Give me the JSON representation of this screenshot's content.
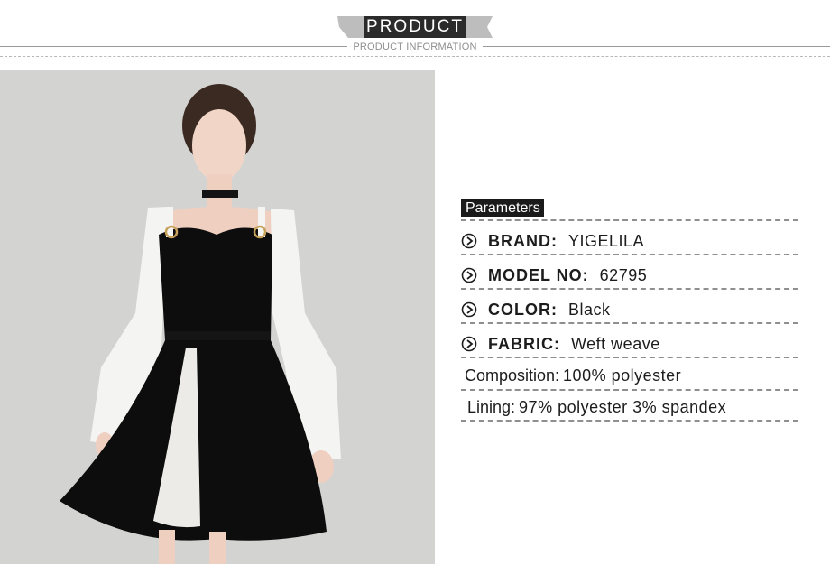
{
  "header": {
    "title": "PRODUCT",
    "subtitle": "PRODUCT INFORMATION"
  },
  "photo": {
    "alt": "Model wearing black cold-shoulder dress with white flared sleeves"
  },
  "parameters": {
    "heading": "Parameters",
    "rows": [
      {
        "label": "BRAND:",
        "value": "YIGELILA"
      },
      {
        "label": "MODEL NO:",
        "value": "62795"
      },
      {
        "label": "COLOR:",
        "value": "Black"
      },
      {
        "label": "FABRIC:",
        "value": "Weft weave"
      },
      {
        "label": "Composition:",
        "value": "100% polyester"
      },
      {
        "label": "Lining:",
        "value": "97% polyester 3% spandex"
      }
    ]
  },
  "colors": {
    "banner": "#2b2b2b",
    "ribbon": "#bdbdbd",
    "photo_bg": "#d3d3d1",
    "dress": "#0d0d0d",
    "sleeve": "#f4f4f2"
  }
}
